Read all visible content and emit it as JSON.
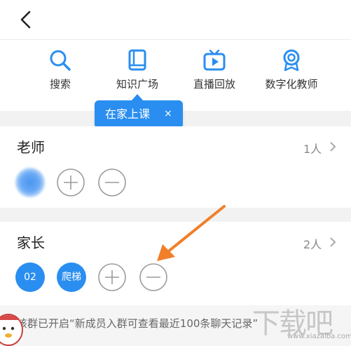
{
  "actions": [
    {
      "label": "搜索",
      "icon": "search-icon"
    },
    {
      "label": "知识广场",
      "icon": "book-icon"
    },
    {
      "label": "直播回放",
      "icon": "tv-play-icon"
    },
    {
      "label": "数字化教师",
      "icon": "award-badge-icon"
    }
  ],
  "tooltip": {
    "text": "在家上课",
    "close": "×"
  },
  "teacher": {
    "title": "老师",
    "count": "1人"
  },
  "parent": {
    "title": "家长",
    "count": "2人",
    "members": [
      "02",
      "爬梯"
    ]
  },
  "notice": {
    "text": "该群已开启“新成员入群可查看最近100条聊天记录”"
  },
  "watermark": {
    "text": "下载吧",
    "url": "www.xiazaiba.com"
  },
  "colors": {
    "accent": "#2a8ef0",
    "annotation_arrow": "#f07f2a"
  }
}
